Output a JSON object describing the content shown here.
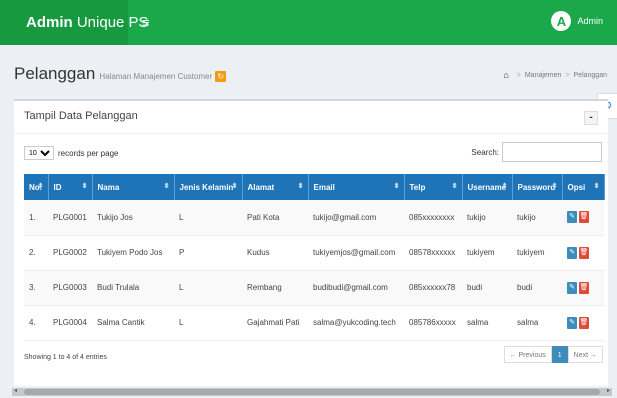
{
  "header": {
    "logo_bold": "Admin",
    "logo_rest": " Unique PS",
    "menu_icon": "≡",
    "avatar_letter": "A",
    "user_name": "Admin"
  },
  "page": {
    "title": "Pelanggan",
    "subtitle": "Halaman Manajemen Customer",
    "refresh_icon": "↻"
  },
  "breadcrumb": {
    "home_icon": "⌂",
    "items": [
      "Manajemen",
      "Pelanggan"
    ],
    "separator": ">"
  },
  "box": {
    "title": "Tampil Data Pelanggan",
    "minimize_label": "-"
  },
  "table_controls": {
    "length_value": "10",
    "length_suffix": "records per page",
    "search_label": "Search:",
    "search_value": ""
  },
  "table": {
    "columns": [
      "No.",
      "ID",
      "Nama",
      "Jenis Kelamin",
      "Alamat",
      "Email",
      "Telp",
      "Username",
      "Password",
      "Opsi"
    ],
    "rows": [
      [
        "1.",
        "PLG0001",
        "Tukijo Jos",
        "L",
        "Pati Kota",
        "tukijo@gmail.com",
        "085xxxxxxxx",
        "tukijo",
        "tukijo"
      ],
      [
        "2.",
        "PLG0002",
        "Tukiyem Podo Jos",
        "P",
        "Kudus",
        "tukiyemjos@gmail.com",
        "08578xxxxxx",
        "tukiyem",
        "tukiyem"
      ],
      [
        "3.",
        "PLG0003",
        "Budi Trulala",
        "L",
        "Rembang",
        "budibudi@gmail.com",
        "085xxxxxx78",
        "budi",
        "budi"
      ],
      [
        "4.",
        "PLG0004",
        "Salma Cantik",
        "L",
        "Gajahmati Pati",
        "salma@yukcoding.tech",
        "085786xxxxx",
        "salma",
        "salma"
      ]
    ],
    "edit_icon": "✎",
    "delete_icon": "🗑"
  },
  "footer": {
    "info": "Showing 1 to 4 of 4 entries",
    "prev": "← Previous",
    "page": "1",
    "next": "Next →"
  },
  "settings_icon": "⚙"
}
